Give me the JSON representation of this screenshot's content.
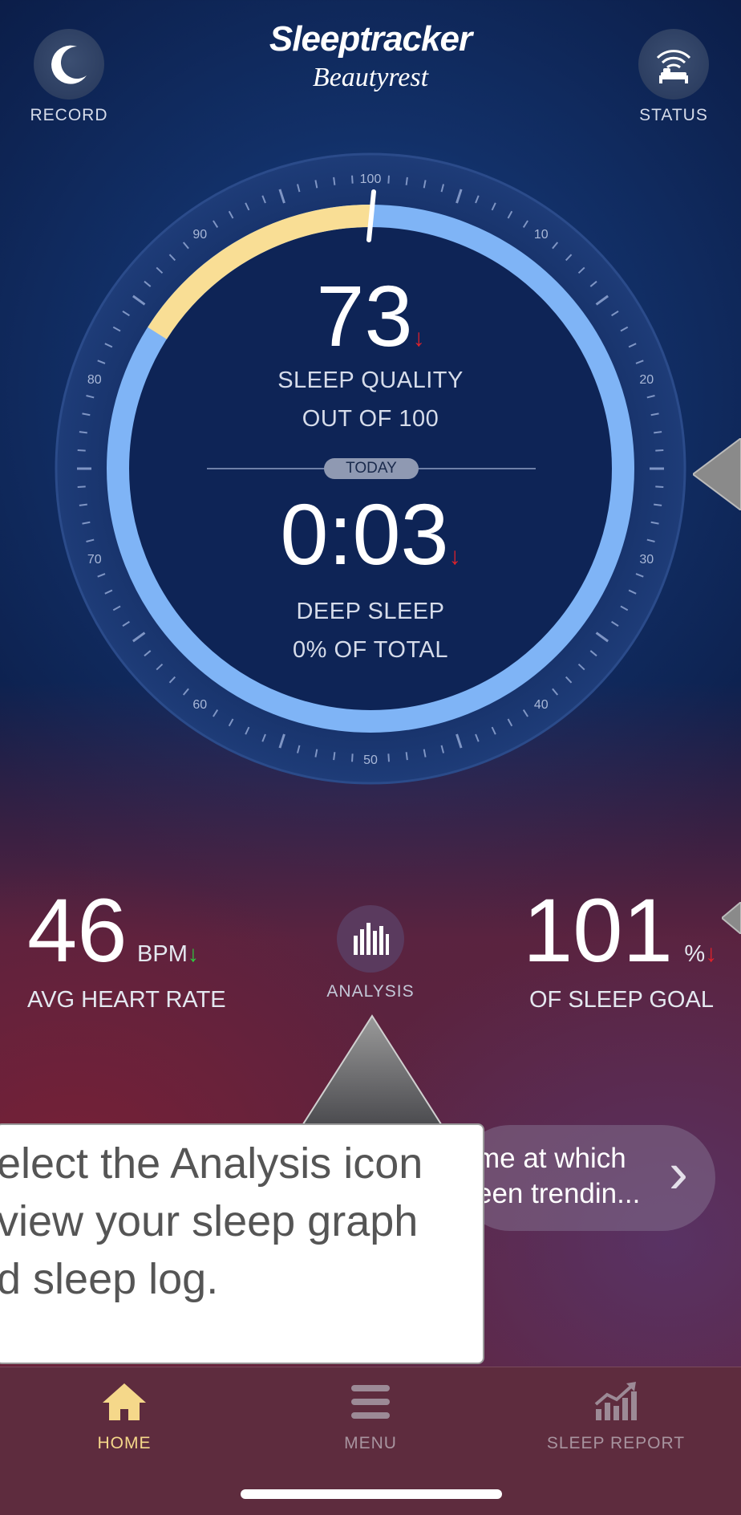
{
  "header": {
    "brand": "Sleeptracker",
    "sub_brand": "Beautyrest",
    "record_label": "RECORD",
    "status_label": "STATUS"
  },
  "dial": {
    "ticks": [
      "100",
      "10",
      "20",
      "30",
      "40",
      "50",
      "60",
      "70",
      "80",
      "90"
    ],
    "sleep_quality_value": "73",
    "sleep_quality_label": "SLEEP QUALITY",
    "sleep_quality_sub": "OUT OF 100",
    "today_label": "TODAY",
    "deep_sleep_value": "0:03",
    "deep_sleep_label": "DEEP SLEEP",
    "deep_sleep_sub": "0% OF TOTAL",
    "progress_fraction": 0.16,
    "down_arrow": "↓"
  },
  "stats": {
    "heart_rate_value": "46",
    "heart_rate_unit": "BPM",
    "heart_rate_label": "AVG HEART RATE",
    "analysis_label": "ANALYSIS",
    "sleep_goal_value": "101",
    "sleep_goal_unit": "%",
    "sleep_goal_label": "OF SLEEP GOAL",
    "down_arrow": "↓"
  },
  "insight": {
    "line1": "me at which",
    "line2": "een trendin...",
    "chevron": "›"
  },
  "callout": {
    "line1": "elect the Analysis icon",
    "line2": " view your sleep graph",
    "line3": "d sleep log."
  },
  "tabs": {
    "home": "HOME",
    "menu": "MENU",
    "sleep_report": "SLEEP REPORT"
  },
  "colors": {
    "gold": "#f5d88a",
    "ring_blue": "#7fb4f6",
    "ring_yellow": "#f9de95",
    "accent_red": "#e0222a",
    "accent_green": "#2ecc40"
  },
  "icons": {
    "record": "moon-icon",
    "status": "bed-wifi-icon",
    "analysis": "bar-chart-icon",
    "home": "house-icon",
    "menu": "hamburger-icon",
    "sleep_report": "trend-chart-icon"
  }
}
